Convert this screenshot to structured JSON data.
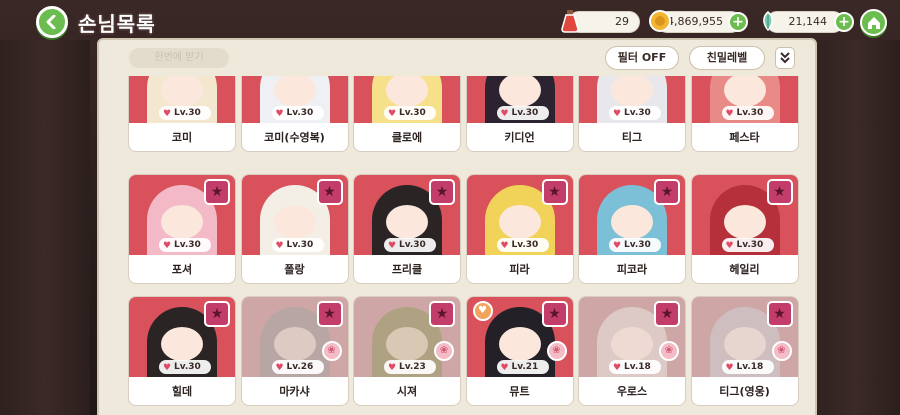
{
  "header": {
    "title": "손님목록",
    "resources": [
      {
        "name": "potion",
        "icon": "potion-icon",
        "value": "29"
      },
      {
        "name": "gold",
        "icon": "coin-icon",
        "value": "4,869,955"
      },
      {
        "name": "leaf",
        "icon": "leaf-icon",
        "value": "21,144"
      }
    ]
  },
  "toolbar": {
    "only_toggle": "한번에 받기",
    "filter_label": "필터 OFF",
    "sort_label": "친밀레벨"
  },
  "colors": {
    "accent_green": "#6cbd4f",
    "card_art": "#d9515a",
    "star_badge": "#c23d6a",
    "panel_bg": "#efe9dc"
  },
  "guests": [
    {
      "name": "코미",
      "level": "Lv.30",
      "star": false,
      "gift": false,
      "new_heart": false,
      "dim": false,
      "hair": "#f3e7cf"
    },
    {
      "name": "코미(수영복)",
      "level": "Lv.30",
      "star": false,
      "gift": false,
      "new_heart": false,
      "dim": false,
      "hair": "#eef0f4"
    },
    {
      "name": "클로에",
      "level": "Lv.30",
      "star": false,
      "gift": false,
      "new_heart": false,
      "dim": false,
      "hair": "#f6e08a"
    },
    {
      "name": "키디언",
      "level": "Lv.30",
      "star": false,
      "gift": false,
      "new_heart": false,
      "dim": false,
      "hair": "#2b2430"
    },
    {
      "name": "티그",
      "level": "Lv.30",
      "star": false,
      "gift": false,
      "new_heart": false,
      "dim": false,
      "hair": "#e8e8ec"
    },
    {
      "name": "페스타",
      "level": "Lv.30",
      "star": false,
      "gift": false,
      "new_heart": false,
      "dim": false,
      "hair": "#e88a86"
    },
    {
      "name": "포셔",
      "level": "Lv.30",
      "star": true,
      "gift": false,
      "new_heart": false,
      "dim": false,
      "hair": "#f4b9c6"
    },
    {
      "name": "폴랑",
      "level": "Lv.30",
      "star": true,
      "gift": false,
      "new_heart": false,
      "dim": false,
      "hair": "#f3efe6"
    },
    {
      "name": "프리클",
      "level": "Lv.30",
      "star": true,
      "gift": false,
      "new_heart": false,
      "dim": false,
      "hair": "#2a2424"
    },
    {
      "name": "피라",
      "level": "Lv.30",
      "star": true,
      "gift": false,
      "new_heart": false,
      "dim": false,
      "hair": "#f2d35a"
    },
    {
      "name": "피코라",
      "level": "Lv.30",
      "star": true,
      "gift": false,
      "new_heart": false,
      "dim": false,
      "hair": "#7cc0d8"
    },
    {
      "name": "헤일리",
      "level": "Lv.30",
      "star": true,
      "gift": false,
      "new_heart": false,
      "dim": false,
      "hair": "#b5303a"
    },
    {
      "name": "힐데",
      "level": "Lv.30",
      "star": true,
      "gift": false,
      "new_heart": false,
      "dim": false,
      "hair": "#2a2424"
    },
    {
      "name": "마카샤",
      "level": "Lv.26",
      "star": true,
      "gift": true,
      "new_heart": false,
      "dim": true,
      "hair": "#a9a7a3"
    },
    {
      "name": "시져",
      "level": "Lv.23",
      "star": true,
      "gift": true,
      "new_heart": false,
      "dim": true,
      "hair": "#9aa06a"
    },
    {
      "name": "뮤트",
      "level": "Lv.21",
      "star": true,
      "gift": true,
      "new_heart": true,
      "dim": false,
      "hair": "#242028"
    },
    {
      "name": "우로스",
      "level": "Lv.18",
      "star": true,
      "gift": true,
      "new_heart": false,
      "dim": true,
      "hair": "#e6e2de"
    },
    {
      "name": "티그(영웅)",
      "level": "Lv.18",
      "star": true,
      "gift": true,
      "new_heart": false,
      "dim": true,
      "hair": "#cfcfd2"
    }
  ]
}
